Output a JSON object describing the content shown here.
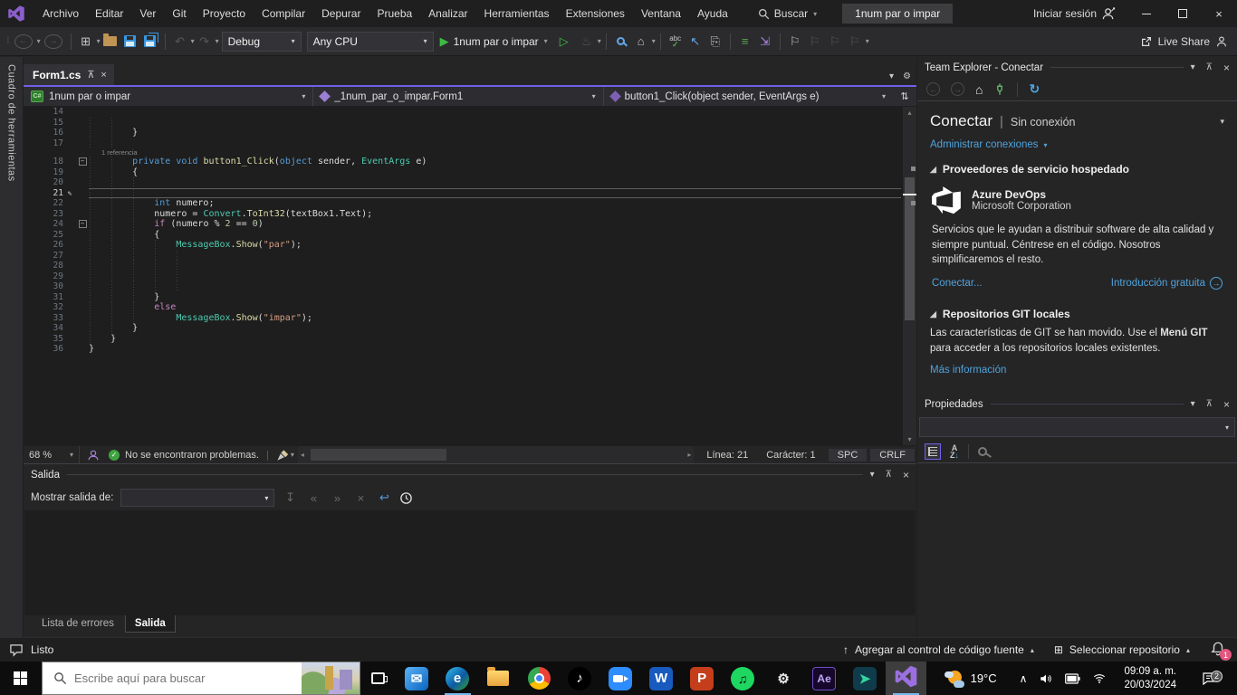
{
  "icons": {
    "caret_down": "▾",
    "caret_up": "▴",
    "tri_up": "▲",
    "close": "×",
    "pin": "⊼",
    "back": "←",
    "fwd": "→",
    "undo": "↶",
    "redo": "↷",
    "play": "▶",
    "play_outline": "▷",
    "flame": "♨",
    "home": "⌂",
    "refresh": "↻",
    "flag": "⚐",
    "arrow_up": "↑",
    "grid": "⊞",
    "chev_l": "◂",
    "chev_r": "▸",
    "check": "✓",
    "pencil": "✎",
    "wrap": "↩",
    "prev_msg": "«",
    "next_msg": "»",
    "clear": "×",
    "collapse": "↧",
    "chevron_up": "∧",
    "gear": "⚙",
    "split": "⇅",
    "fold_minus": "−",
    "sect_tri": "◢",
    "dots": "⁞",
    "indent": "≡",
    "abc": "abc",
    "newproj": "⊞"
  },
  "window": {
    "title_box": "1num par o impar"
  },
  "menu_bar": {
    "items": [
      "Archivo",
      "Editar",
      "Ver",
      "Git",
      "Proyecto",
      "Compilar",
      "Depurar",
      "Prueba",
      "Analizar",
      "Herramientas",
      "Extensiones",
      "Ventana",
      "Ayuda"
    ],
    "search_label": "Buscar",
    "sign_in_label": "Iniciar sesión"
  },
  "toolbar": {
    "config": "Debug",
    "platform": "Any CPU",
    "run_label": "1num par o impar",
    "live_share_label": "Live Share"
  },
  "left_strip": {
    "label": "Cuadro de herramientas"
  },
  "editor": {
    "tab_label": "Form1.cs",
    "nav": {
      "project": "1num par o impar",
      "type": "_1num_par_o_impar.Form1",
      "member": "button1_Click(object sender, EventArgs e)"
    },
    "code": {
      "lines": [
        {
          "n": 14,
          "t": [],
          "g": []
        },
        {
          "n": 15,
          "t": [],
          "g": [
            0,
            4
          ]
        },
        {
          "n": 16,
          "t": [
            [
              "pl",
              "        }"
            ]
          ],
          "g": [
            0,
            4
          ]
        },
        {
          "n": 17,
          "t": [],
          "g": [
            0,
            4
          ]
        },
        {
          "n": 18,
          "lens": "1 referencia",
          "fold": true,
          "t": [
            [
              "pl",
              "        "
            ],
            [
              "kw",
              "private"
            ],
            [
              "pl",
              " "
            ],
            [
              "kw",
              "void"
            ],
            [
              "pl",
              " "
            ],
            [
              "me",
              "button1_Click"
            ],
            [
              "pl",
              "("
            ],
            [
              "kw",
              "object"
            ],
            [
              "pl",
              " sender, "
            ],
            [
              "ty",
              "EventArgs"
            ],
            [
              "pl",
              " e)"
            ]
          ],
          "g": [
            0,
            4
          ]
        },
        {
          "n": 19,
          "t": [
            [
              "pl",
              "        {"
            ]
          ],
          "g": [
            0,
            4
          ]
        },
        {
          "n": 20,
          "t": [],
          "g": [
            0,
            4,
            8
          ]
        },
        {
          "n": 21,
          "current": true,
          "t": [],
          "g": [
            0,
            4,
            8
          ]
        },
        {
          "n": 22,
          "t": [
            [
              "pl",
              "            "
            ],
            [
              "kw",
              "int"
            ],
            [
              "pl",
              " numero;"
            ]
          ],
          "g": [
            0,
            4,
            8
          ]
        },
        {
          "n": 23,
          "t": [
            [
              "pl",
              "            numero = "
            ],
            [
              "ty",
              "Convert"
            ],
            [
              "pl",
              "."
            ],
            [
              "me",
              "ToInt32"
            ],
            [
              "pl",
              "(textBox1.Text);"
            ]
          ],
          "g": [
            0,
            4,
            8
          ]
        },
        {
          "n": 24,
          "fold": true,
          "t": [
            [
              "pl",
              "            "
            ],
            [
              "ct",
              "if"
            ],
            [
              "pl",
              " (numero % "
            ],
            [
              "nu",
              "2"
            ],
            [
              "pl",
              " == "
            ],
            [
              "nu",
              "0"
            ],
            [
              "pl",
              ")"
            ]
          ],
          "g": [
            0,
            4,
            8
          ]
        },
        {
          "n": 25,
          "t": [
            [
              "pl",
              "            {"
            ]
          ],
          "g": [
            0,
            4,
            8
          ]
        },
        {
          "n": 26,
          "t": [
            [
              "pl",
              "                "
            ],
            [
              "ty",
              "MessageBox"
            ],
            [
              "pl",
              "."
            ],
            [
              "me",
              "Show"
            ],
            [
              "pl",
              "("
            ],
            [
              "st",
              "\"par\""
            ],
            [
              "pl",
              ");"
            ]
          ],
          "g": [
            0,
            4,
            8,
            12
          ]
        },
        {
          "n": 27,
          "t": [],
          "g": [
            0,
            4,
            8,
            12,
            16
          ]
        },
        {
          "n": 28,
          "t": [],
          "g": [
            0,
            4,
            8,
            12,
            16
          ]
        },
        {
          "n": 29,
          "t": [],
          "g": [
            0,
            4,
            8,
            12,
            16
          ]
        },
        {
          "n": 30,
          "t": [],
          "g": [
            0,
            4,
            8,
            12,
            16
          ]
        },
        {
          "n": 31,
          "t": [
            [
              "pl",
              "            }"
            ]
          ],
          "g": [
            0,
            4,
            8
          ]
        },
        {
          "n": 32,
          "t": [
            [
              "pl",
              "            "
            ],
            [
              "ct",
              "else"
            ]
          ],
          "g": [
            0,
            4,
            8
          ]
        },
        {
          "n": 33,
          "t": [
            [
              "pl",
              "                "
            ],
            [
              "ty",
              "MessageBox"
            ],
            [
              "pl",
              "."
            ],
            [
              "me",
              "Show"
            ],
            [
              "pl",
              "("
            ],
            [
              "st",
              "\"impar\""
            ],
            [
              "pl",
              ");"
            ]
          ],
          "g": [
            0,
            4,
            8
          ]
        },
        {
          "n": 34,
          "t": [
            [
              "pl",
              "        }"
            ]
          ],
          "g": [
            0,
            4
          ]
        },
        {
          "n": 35,
          "t": [
            [
              "pl",
              "    }"
            ]
          ],
          "g": [
            0
          ]
        },
        {
          "n": 36,
          "t": [
            [
              "pl",
              "}"
            ]
          ],
          "g": []
        }
      ]
    },
    "status": {
      "zoom": "68 %",
      "problems": "No se encontraron problemas.",
      "line": "Línea: 21",
      "column": "Carácter: 1",
      "spaces": "SPC",
      "line_ending": "CRLF"
    }
  },
  "team_explorer": {
    "title": "Team Explorer - Conectar",
    "page_title": "Conectar",
    "page_status": "Sin conexión",
    "manage_connections": "Administrar conexiones",
    "hosted_header": "Proveedores de servicio hospedado",
    "azure": {
      "name": "Azure DevOps",
      "vendor": "Microsoft Corporation",
      "description": "Servicios que le ayudan a distribuir software de alta calidad y siempre puntual. Céntrese en el código. Nosotros simplificaremos el resto.",
      "connect_link": "Conectar...",
      "intro_link": "Introducción gratuita"
    },
    "git_header": "Repositorios GIT locales",
    "git_text_1": "Las características de GIT se han movido. Use el ",
    "git_text_bold": "Menú GIT",
    "git_text_2": " para acceder a los repositorios locales existentes.",
    "more_info": "Más información"
  },
  "properties_panel": {
    "title": "Propiedades"
  },
  "output_panel": {
    "title": "Salida",
    "show_label": "Mostrar salida de:",
    "combo_value": ""
  },
  "bottom_tabs": {
    "errors": "Lista de errores",
    "output": "Salida"
  },
  "status_bar": {
    "ready": "Listo",
    "add_scc": "Agregar al control de código fuente",
    "select_repo": "Seleccionar repositorio",
    "badge": "1"
  },
  "taskbar": {
    "search_placeholder": "Escribe aquí para buscar",
    "temperature": "19°C",
    "time": "09:09 a. m.",
    "date": "20/03/2024",
    "notif_badge": "2",
    "apps": [
      {
        "name": "mail",
        "kind": "glyph",
        "glyph": "✉",
        "bg": "linear-gradient(135deg,#5ab2f5,#0b64c0)",
        "fg": "#fff"
      },
      {
        "name": "edge",
        "kind": "glyph",
        "shape": "circle",
        "glyph": "e",
        "bg": "linear-gradient(135deg,#35c1f1,#0c59a4 55%,#35a32e)",
        "fg": "#fff",
        "running": true
      },
      {
        "name": "file-explorer",
        "kind": "folder"
      },
      {
        "name": "chrome",
        "kind": "chrome"
      },
      {
        "name": "tiktok",
        "kind": "glyph",
        "shape": "circle",
        "glyph": "♪",
        "bg": "#000",
        "fg": "#fff"
      },
      {
        "name": "zoom",
        "kind": "zoom"
      },
      {
        "name": "word",
        "kind": "glyph",
        "glyph": "W",
        "bg": "#185abd",
        "fg": "#fff"
      },
      {
        "name": "powerpoint",
        "kind": "glyph",
        "glyph": "P",
        "bg": "#c43e1c",
        "fg": "#fff"
      },
      {
        "name": "spotify",
        "kind": "spotify",
        "glyph": "♫"
      },
      {
        "name": "settings",
        "kind": "glyph",
        "glyph": "⚙",
        "bg": "transparent",
        "fg": "#e8e8e8"
      },
      {
        "name": "after-effects",
        "kind": "ae",
        "glyph": "Ae"
      },
      {
        "name": "phone-link",
        "kind": "glyph",
        "glyph": "➤",
        "bg": "#0f3b4a",
        "fg": "#35d3a0"
      },
      {
        "name": "visual-studio",
        "kind": "vs",
        "running": true,
        "active": true
      }
    ]
  }
}
